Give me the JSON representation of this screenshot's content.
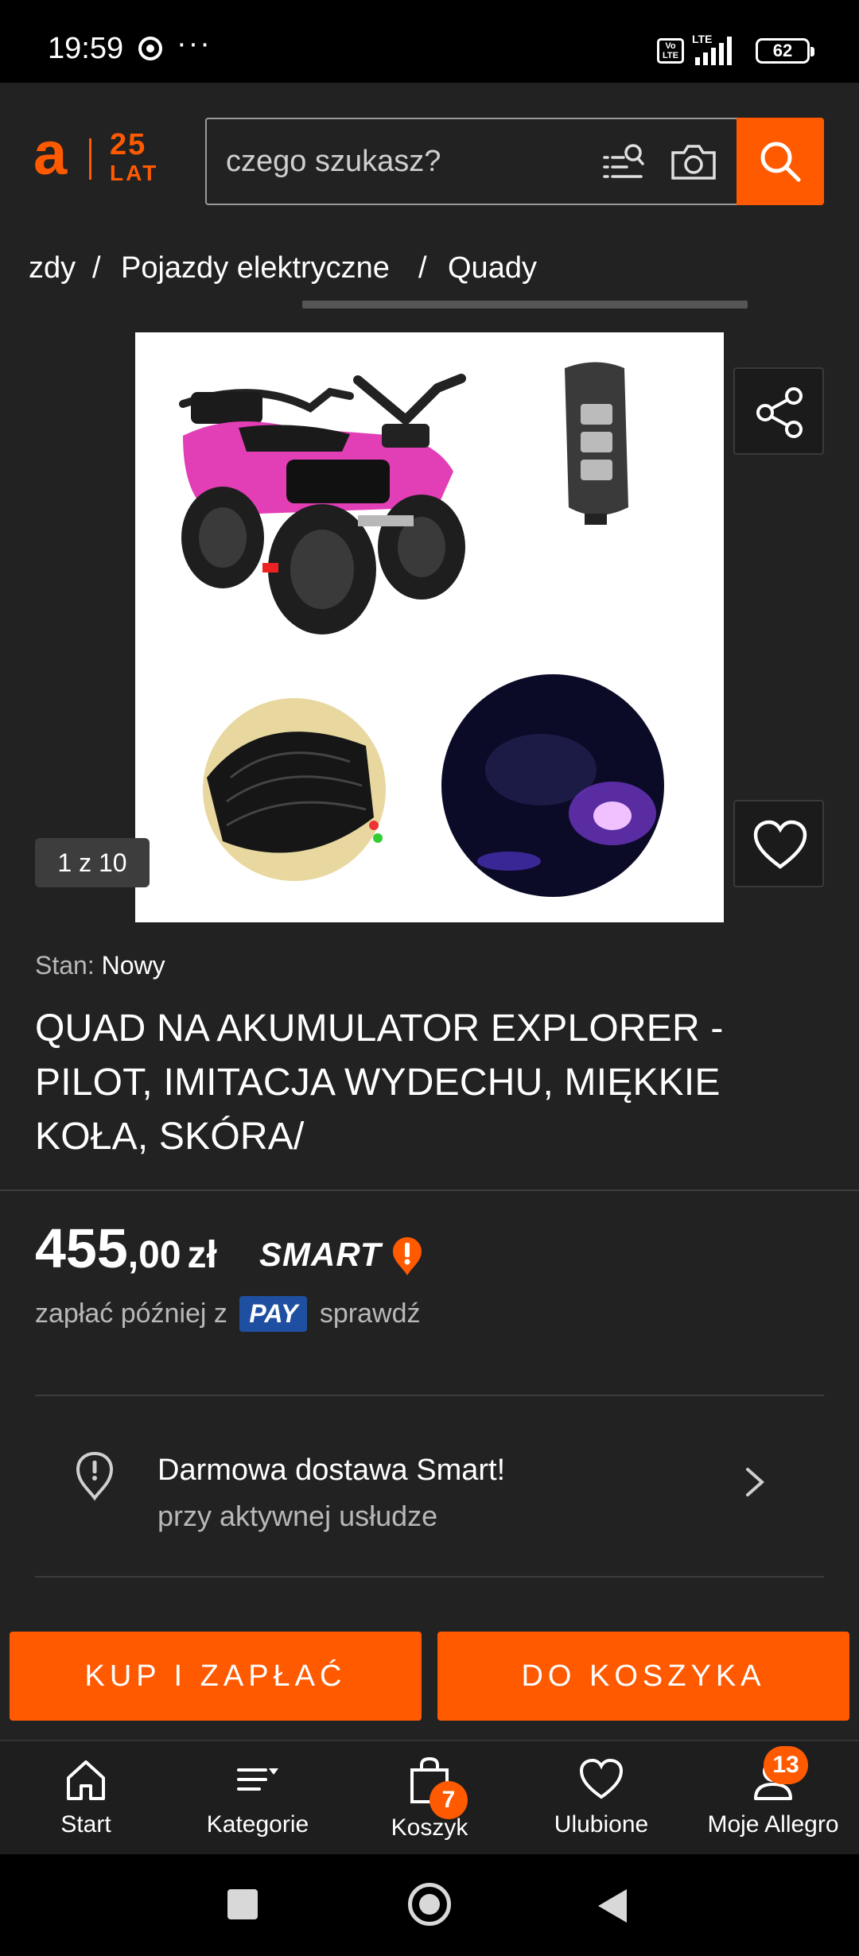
{
  "status_bar": {
    "time": "19:59",
    "dots": "···",
    "volte": "Vo LTE",
    "network": "LTE",
    "battery": "62"
  },
  "header": {
    "logo_letter": "a",
    "logo_years": "25",
    "logo_lat": "LAT",
    "search_placeholder": "czego szukasz?",
    "accent_color": "#ff5a00"
  },
  "breadcrumb": {
    "items": [
      "zdy",
      "Pojazdy elektryczne",
      "Quady"
    ],
    "separator": "/"
  },
  "gallery": {
    "counter": "1 z 10"
  },
  "product": {
    "condition_label": "Stan:",
    "condition_value": "Nowy",
    "title": "QUAD NA AKUMULATOR EXPLORER - PILOT, IMITACJA WYDECHU, MIĘKKIE KOŁA, SKÓRA/",
    "price_main": "455",
    "price_cents": ",00",
    "price_currency": "zł",
    "smart_label": "SMART",
    "paylater_prefix": "zapłać później z",
    "pay_badge": "PAY",
    "paylater_check": "sprawdź"
  },
  "delivery": {
    "title": "Darmowa dostawa Smart!",
    "subtitle": "przy aktywnej usłudze"
  },
  "actions": {
    "buy_label": "KUP I ZAPŁAĆ",
    "cart_label": "DO KOSZYKA"
  },
  "bottom_nav": {
    "items": [
      {
        "label": "Start",
        "icon": "home-icon"
      },
      {
        "label": "Kategorie",
        "icon": "categories-icon"
      },
      {
        "label": "Koszyk",
        "icon": "cart-icon",
        "badge": "7"
      },
      {
        "label": "Ulubione",
        "icon": "heart-icon"
      },
      {
        "label": "Moje Allegro",
        "icon": "user-icon",
        "badge": "13"
      }
    ]
  }
}
